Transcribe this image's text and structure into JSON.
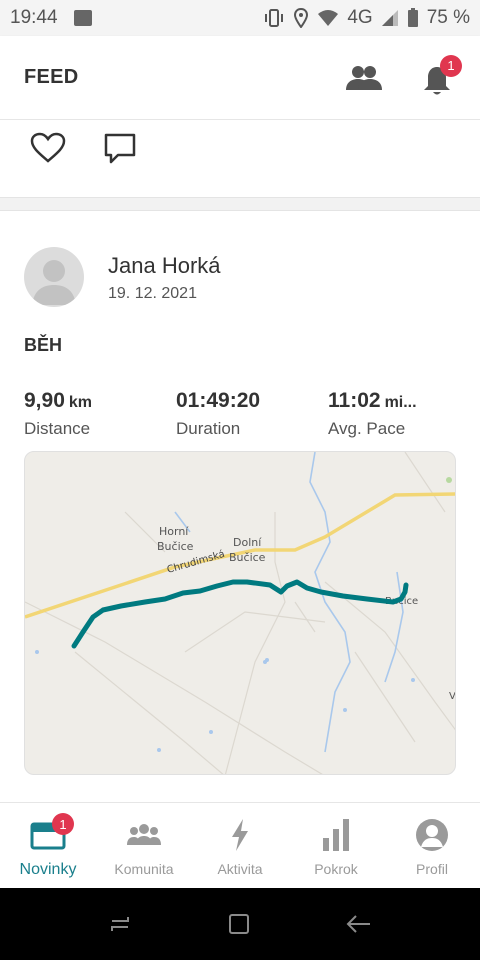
{
  "status_bar": {
    "time": "19:44",
    "network": "4G",
    "battery": "75 %"
  },
  "header": {
    "title": "FEED",
    "notification_count": "1"
  },
  "post": {
    "user_name": "Jana Horká",
    "date": "19. 12. 2021",
    "activity_type": "BĚH",
    "stats": [
      {
        "value": "9,90",
        "unit": "km",
        "label": "Distance"
      },
      {
        "value": "01:49:20",
        "unit": "",
        "label": "Duration"
      },
      {
        "value": "11:02",
        "unit": "mi...",
        "label": "Avg. Pace"
      }
    ],
    "map": {
      "road_name": "Chrudimská",
      "place_1_line1": "Horní",
      "place_1_line2": "Bučice",
      "place_2_line1": "Dolní",
      "place_2_line2": "Bučice",
      "place_3": "Bučice",
      "route_color": "#007a80",
      "road_color": "#f2d675"
    }
  },
  "bottom_nav": {
    "items": [
      {
        "label": "Novinky",
        "icon": "feed-icon",
        "badge": "1",
        "active": true
      },
      {
        "label": "Komunita",
        "icon": "community-icon"
      },
      {
        "label": "Aktivita",
        "icon": "lightning-icon"
      },
      {
        "label": "Pokrok",
        "icon": "bar-chart-icon"
      },
      {
        "label": "Profil",
        "icon": "profile-icon"
      }
    ]
  },
  "colors": {
    "accent": "#1a7f8c",
    "badge": "#e0364f"
  }
}
